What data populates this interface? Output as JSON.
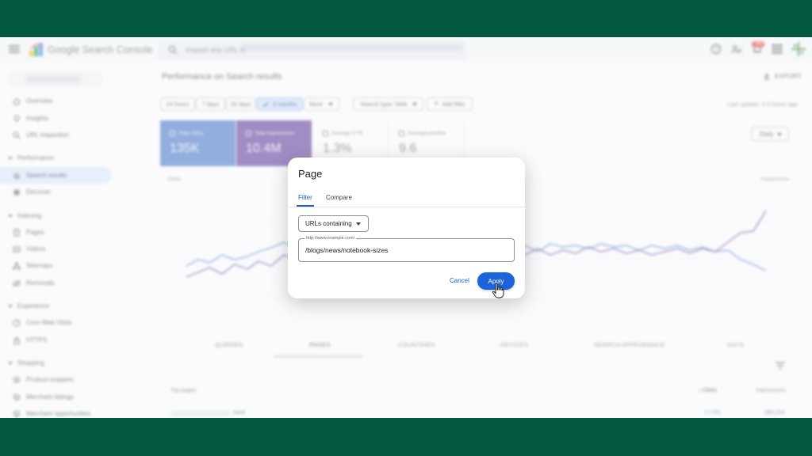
{
  "app": {
    "brand": "Google Search Console",
    "search_placeholder": "Inspect any URL in",
    "notification_count": "189"
  },
  "sidebar": {
    "items": [
      {
        "label": "Overview",
        "icon": "home-icon"
      },
      {
        "label": "Insights",
        "icon": "lightbulb-icon"
      },
      {
        "label": "URL inspection",
        "icon": "search-icon"
      }
    ],
    "sections": [
      {
        "title": "Performance",
        "items": [
          {
            "label": "Search results",
            "icon": "google-g-icon",
            "active": true
          },
          {
            "label": "Discover",
            "icon": "asterisk-icon"
          }
        ]
      },
      {
        "title": "Indexing",
        "items": [
          {
            "label": "Pages",
            "icon": "pages-icon"
          },
          {
            "label": "Videos",
            "icon": "video-icon"
          },
          {
            "label": "Sitemaps",
            "icon": "sitemap-icon"
          },
          {
            "label": "Removals",
            "icon": "removals-icon"
          }
        ]
      },
      {
        "title": "Experience",
        "items": [
          {
            "label": "Core Web Vitals",
            "icon": "gauge-icon"
          },
          {
            "label": "HTTPS",
            "icon": "lock-icon"
          }
        ]
      },
      {
        "title": "Shopping",
        "items": [
          {
            "label": "Product snippets",
            "icon": "layers-icon"
          },
          {
            "label": "Merchant listings",
            "icon": "layers-icon"
          },
          {
            "label": "Merchant opportunities",
            "icon": "layers-icon"
          }
        ]
      }
    ]
  },
  "main": {
    "title": "Performance on Search results",
    "export_label": "EXPORT",
    "date_chips": [
      "24 hours",
      "7 days",
      "28 days",
      "3 months",
      "More"
    ],
    "selected_chip": "3 months",
    "search_type": "Search type: Web",
    "add_filter": "Add filter",
    "last_update": "Last update: 3.5 hours ago",
    "granularity": "Daily",
    "cards": [
      {
        "label": "Total clicks",
        "value": "135K",
        "checked": true
      },
      {
        "label": "Total impressions",
        "value": "10.4M",
        "checked": true
      },
      {
        "label": "Average CTR",
        "value": "1.3%",
        "checked": false
      },
      {
        "label": "Average position",
        "value": "9.6",
        "checked": false
      }
    ],
    "axis_left_label": "Clicks",
    "axis_right_label": "Impressions",
    "tabs": [
      "QUERIES",
      "PAGES",
      "COUNTRIES",
      "DEVICES",
      "SEARCH APPEARANCE",
      "DAYS"
    ],
    "active_tab": "PAGES",
    "table": {
      "col_page": "Top pages",
      "col_clicks": "Clicks",
      "col_impressions": "Impressions",
      "rows": [
        {
          "page": "com/",
          "clicks": "17,031",
          "impressions": "263,214"
        }
      ]
    }
  },
  "dialog": {
    "title": "Page",
    "tabs": [
      "Filter",
      "Compare"
    ],
    "active_tab": "Filter",
    "match_type": "URLs containing",
    "field_label": "http://www.example.com/",
    "field_value": "/blogs/news/notebook-sizes",
    "cancel_label": "Cancel",
    "apply_label": "Apply"
  },
  "colors": {
    "backdrop": "#035940",
    "clicks_series": "#4473c7",
    "impressions_series": "#5a3b9a",
    "accent": "#1a63d8"
  }
}
